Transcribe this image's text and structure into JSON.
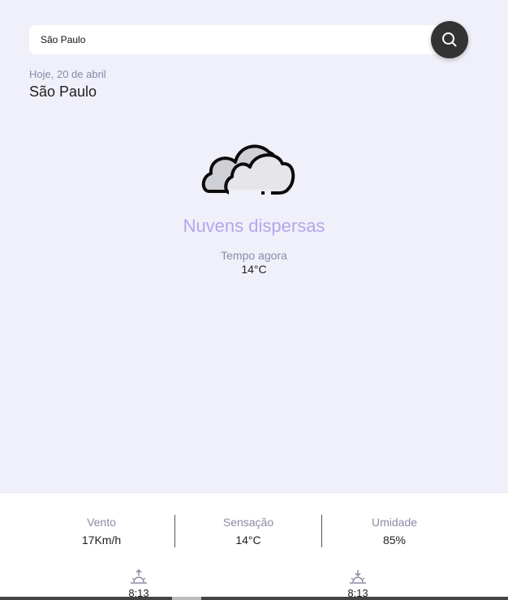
{
  "search": {
    "value": "São Paulo",
    "button_icon": "search-icon"
  },
  "header": {
    "date": "Hoje, 20 de abril",
    "city": "São Paulo"
  },
  "current": {
    "icon": "cloud-icon",
    "condition": "Nuvens dispersas",
    "now_label": "Tempo agora",
    "temperature": "14°C"
  },
  "details": {
    "wind": {
      "label": "Vento",
      "value": "17Km/h"
    },
    "feels_like": {
      "label": "Sensação",
      "value": "14°C"
    },
    "humidity": {
      "label": "Umidade",
      "value": "85%"
    }
  },
  "sun": {
    "sunrise": {
      "icon": "sunrise-icon",
      "time": "8:13"
    },
    "sunset": {
      "icon": "sunset-icon",
      "time": "8:13"
    }
  },
  "colors": {
    "background": "#f0f0fa",
    "accent": "#b3a6ec",
    "muted_text": "#8a8aa8",
    "button": "#333333"
  }
}
